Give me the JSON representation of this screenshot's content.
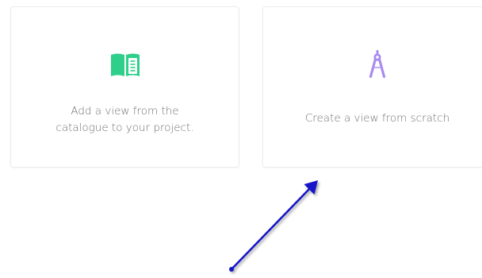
{
  "cards": [
    {
      "icon": "open-book-icon",
      "label_line1": "Add a view from the",
      "label_line2": "catalogue to your project."
    },
    {
      "icon": "compass-icon",
      "label": "Create a view from scratch"
    }
  ],
  "colors": {
    "book_icon": "#2ecf8a",
    "compass_icon": "#a98bf0",
    "card_text": "#707070",
    "card_border": "#ececec",
    "annotation_arrow": "#1515c8"
  }
}
